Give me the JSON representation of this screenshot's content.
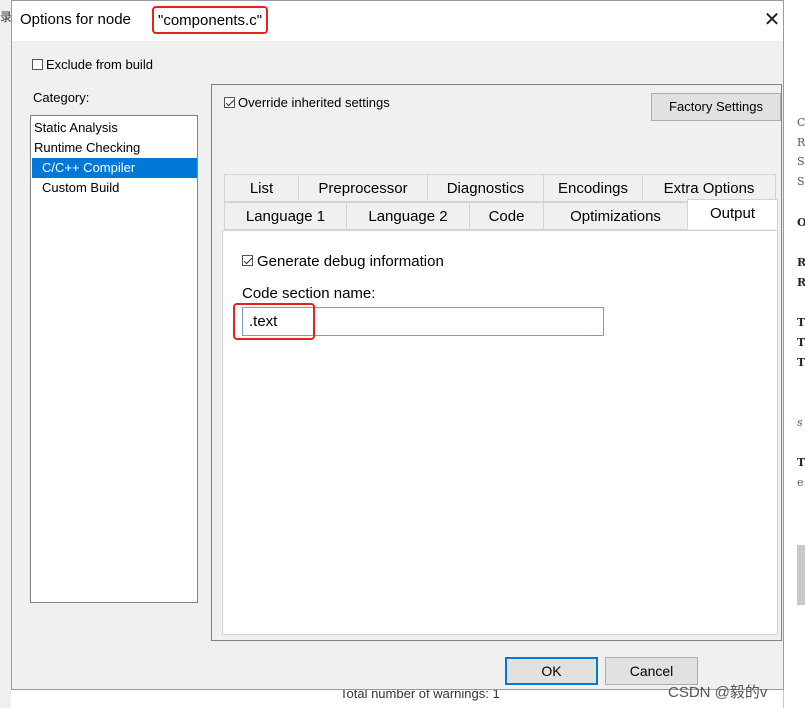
{
  "dialog": {
    "title_prefix": "Options for node",
    "title_node": "\"components.c\"",
    "close_glyph": "✕",
    "exclude_from_build": {
      "label": "Exclude from build",
      "checked": false
    },
    "category_label": "Category:",
    "categories": [
      {
        "label": "Static Analysis",
        "selected": false
      },
      {
        "label": "Runtime Checking",
        "selected": false
      },
      {
        "label": "C/C++ Compiler",
        "selected": true
      },
      {
        "label": "Custom Build",
        "selected": false
      }
    ],
    "override": {
      "label": "Override inherited settings",
      "checked": true
    },
    "factory_settings_label": "Factory Settings",
    "tabs_row1": [
      "List",
      "Preprocessor",
      "Diagnostics",
      "Encodings",
      "Extra Options"
    ],
    "tabs_row2": [
      "Language 1",
      "Language 2",
      "Code",
      "Optimizations",
      "Output"
    ],
    "active_tab": "Output",
    "output": {
      "generate_debug": {
        "label": "Generate debug information",
        "checked": true
      },
      "code_section_label": "Code section name:",
      "code_section_value": ".text"
    },
    "ok_label": "OK",
    "cancel_label": "Cancel"
  },
  "background": {
    "left_char": "录",
    "right_lines": [
      "C",
      "R",
      "S",
      "S",
      "O",
      "R",
      "R",
      "T",
      "T",
      "T",
      "s",
      "T",
      "e"
    ],
    "bottom_text": "Total number of warnings: 1"
  },
  "watermark": "CSDN @毅的v",
  "colors": {
    "highlight": "#e5231c",
    "selection": "#0078d7"
  }
}
